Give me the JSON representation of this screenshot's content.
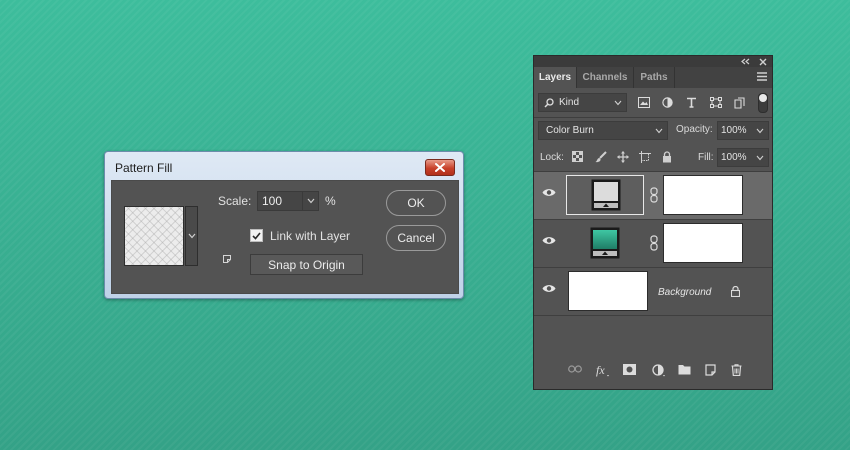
{
  "pattern_dialog": {
    "title": "Pattern Fill",
    "scale_label": "Scale:",
    "scale_value": "100",
    "percent_symbol": "%",
    "link_with_layer_label": "Link with Layer",
    "link_with_layer_checked": true,
    "snap_to_origin_label": "Snap to Origin",
    "ok_label": "OK",
    "cancel_label": "Cancel"
  },
  "layers_panel": {
    "tabs": [
      {
        "label": "Layers",
        "active": true
      },
      {
        "label": "Channels",
        "active": false
      },
      {
        "label": "Paths",
        "active": false
      }
    ],
    "filter_kind": "Kind",
    "blend_mode": "Color Burn",
    "opacity_label": "Opacity:",
    "opacity_value": "100%",
    "lock_label": "Lock:",
    "fill_label": "Fill:",
    "fill_value": "100%",
    "layers": [
      {
        "type": "pattern-fill-adjustment",
        "selected": true,
        "visible": true,
        "name": ""
      },
      {
        "type": "gradient-fill-adjustment",
        "selected": false,
        "visible": true,
        "name": ""
      },
      {
        "type": "background",
        "selected": false,
        "visible": true,
        "name": "Background",
        "locked": true
      }
    ]
  },
  "colors": {
    "canvas_teal": "#3aae92",
    "panel_gray": "#535353",
    "dialog_titlebar": "#dfe9f5",
    "close_button_red": "#c8412a"
  }
}
